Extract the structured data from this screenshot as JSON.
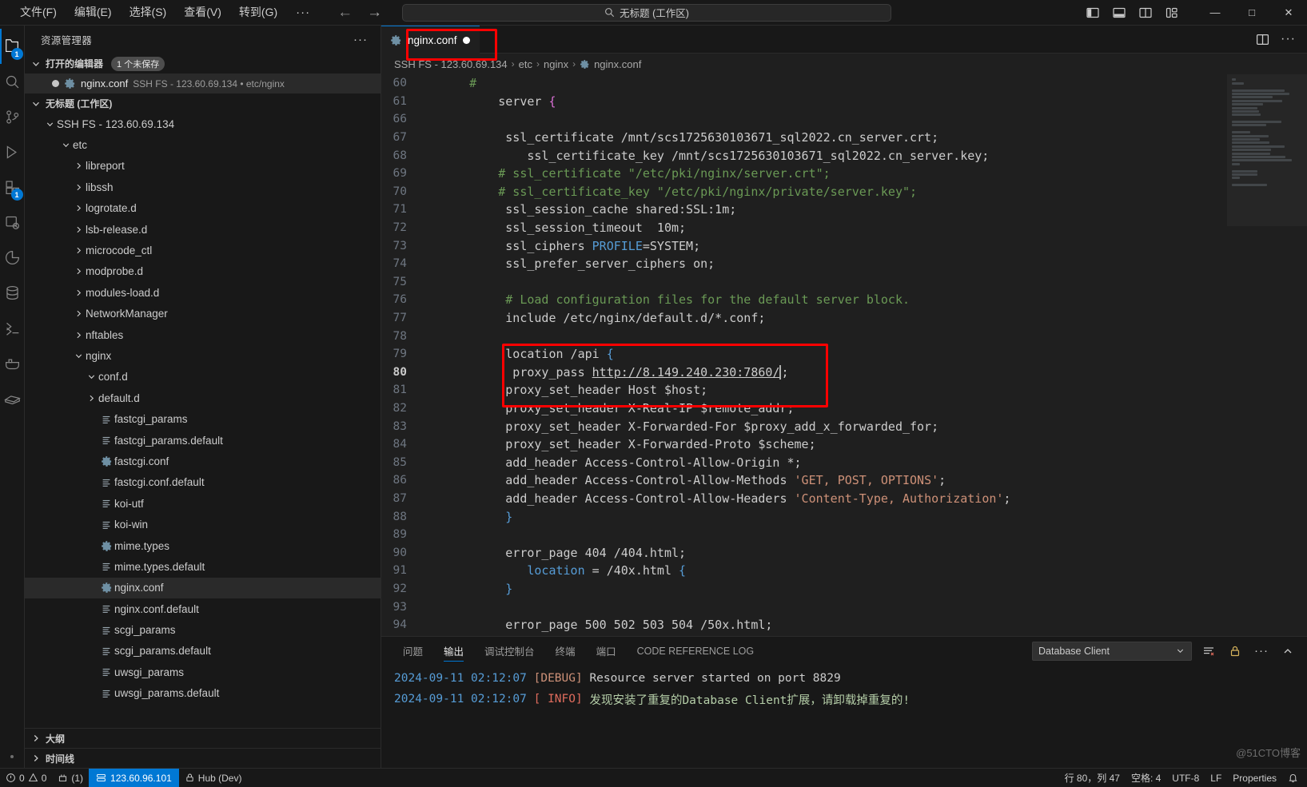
{
  "titlebar": {
    "menus": [
      {
        "label": "文件(F)",
        "name": "menu-file"
      },
      {
        "label": "编辑(E)",
        "name": "menu-edit"
      },
      {
        "label": "选择(S)",
        "name": "menu-selection"
      },
      {
        "label": "查看(V)",
        "name": "menu-view"
      },
      {
        "label": "转到(G)",
        "name": "menu-go"
      }
    ],
    "more_label": "···",
    "back_glyph": "←",
    "forward_glyph": "→",
    "command_center_text": "无标题 (工作区)",
    "minimize_glyph": "—",
    "maximize_glyph": "□",
    "close_glyph": "✕"
  },
  "activitybar": {
    "items": [
      {
        "name": "explorer-icon",
        "badge": "1"
      },
      {
        "name": "search-icon",
        "badge": ""
      },
      {
        "name": "source-control-icon",
        "badge": ""
      },
      {
        "name": "run-debug-icon",
        "badge": ""
      },
      {
        "name": "extensions-icon",
        "badge": "1"
      },
      {
        "name": "remote-explorer-icon",
        "badge": ""
      },
      {
        "name": "test-icon",
        "badge": ""
      },
      {
        "name": "database-icon",
        "badge": ""
      },
      {
        "name": "code-runner-icon",
        "badge": ""
      },
      {
        "name": "docker-icon",
        "badge": ""
      },
      {
        "name": "ssh-fs-icon",
        "badge": ""
      }
    ]
  },
  "sidebar": {
    "title": "资源管理器",
    "more_actions": "···",
    "open_editors": {
      "label": "打开的编辑器",
      "unsaved_badge": "1 个未保存",
      "rows": [
        {
          "name": "nginx.conf",
          "description": "SSH FS - 123.60.69.134 • etc/nginx",
          "icon": "gear-icon",
          "dirty": true
        }
      ]
    },
    "workspace": {
      "label": "无标题 (工作区)",
      "root": "SSH FS - 123.60.69.134"
    },
    "tree": [
      {
        "label": "etc",
        "type": "folder",
        "expanded": true,
        "depth": 2,
        "icon": "chevron-down-icon"
      },
      {
        "label": "libreport",
        "type": "folder",
        "expanded": false,
        "depth": 3,
        "icon": "chevron-right-icon"
      },
      {
        "label": "libssh",
        "type": "folder",
        "expanded": false,
        "depth": 3,
        "icon": "chevron-right-icon"
      },
      {
        "label": "logrotate.d",
        "type": "folder",
        "expanded": false,
        "depth": 3,
        "icon": "chevron-right-icon"
      },
      {
        "label": "lsb-release.d",
        "type": "folder",
        "expanded": false,
        "depth": 3,
        "icon": "chevron-right-icon"
      },
      {
        "label": "microcode_ctl",
        "type": "folder",
        "expanded": false,
        "depth": 3,
        "icon": "chevron-right-icon"
      },
      {
        "label": "modprobe.d",
        "type": "folder",
        "expanded": false,
        "depth": 3,
        "icon": "chevron-right-icon"
      },
      {
        "label": "modules-load.d",
        "type": "folder",
        "expanded": false,
        "depth": 3,
        "icon": "chevron-right-icon"
      },
      {
        "label": "NetworkManager",
        "type": "folder",
        "expanded": false,
        "depth": 3,
        "icon": "chevron-right-icon"
      },
      {
        "label": "nftables",
        "type": "folder",
        "expanded": false,
        "depth": 3,
        "icon": "chevron-right-icon"
      },
      {
        "label": "nginx",
        "type": "folder",
        "expanded": true,
        "depth": 3,
        "icon": "chevron-down-icon"
      },
      {
        "label": "conf.d",
        "type": "folder",
        "expanded": true,
        "depth": 4,
        "icon": "chevron-down-icon"
      },
      {
        "label": "default.d",
        "type": "folder",
        "expanded": false,
        "depth": 4,
        "icon": "chevron-right-icon"
      },
      {
        "label": "fastcgi_params",
        "type": "file",
        "depth": 4,
        "icon": "text-file-icon"
      },
      {
        "label": "fastcgi_params.default",
        "type": "file",
        "depth": 4,
        "icon": "text-file-icon"
      },
      {
        "label": "fastcgi.conf",
        "type": "file",
        "depth": 4,
        "icon": "gear-icon"
      },
      {
        "label": "fastcgi.conf.default",
        "type": "file",
        "depth": 4,
        "icon": "text-file-icon"
      },
      {
        "label": "koi-utf",
        "type": "file",
        "depth": 4,
        "icon": "text-file-icon"
      },
      {
        "label": "koi-win",
        "type": "file",
        "depth": 4,
        "icon": "text-file-icon"
      },
      {
        "label": "mime.types",
        "type": "file",
        "depth": 4,
        "icon": "gear-icon"
      },
      {
        "label": "mime.types.default",
        "type": "file",
        "depth": 4,
        "icon": "text-file-icon"
      },
      {
        "label": "nginx.conf",
        "type": "file",
        "depth": 4,
        "icon": "gear-icon",
        "selected": true
      },
      {
        "label": "nginx.conf.default",
        "type": "file",
        "depth": 4,
        "icon": "text-file-icon"
      },
      {
        "label": "scgi_params",
        "type": "file",
        "depth": 4,
        "icon": "text-file-icon"
      },
      {
        "label": "scgi_params.default",
        "type": "file",
        "depth": 4,
        "icon": "text-file-icon"
      },
      {
        "label": "uwsgi_params",
        "type": "file",
        "depth": 4,
        "icon": "text-file-icon"
      },
      {
        "label": "uwsgi_params.default",
        "type": "file",
        "depth": 4,
        "icon": "text-file-icon"
      }
    ],
    "bottom_sections": [
      {
        "label": "大纲",
        "name": "sidebar-section-outline"
      },
      {
        "label": "时间线",
        "name": "sidebar-section-timeline"
      }
    ]
  },
  "editor": {
    "tab": {
      "label": "nginx.conf",
      "dirty": true,
      "icon": "gear-icon"
    },
    "breadcrumb": [
      "SSH FS - 123.60.69.134",
      "etc",
      "nginx",
      "nginx.conf"
    ],
    "breadcrumb_separator": "›",
    "lines": [
      {
        "num": "60",
        "segments": [
          {
            "t": "    #",
            "c": "cm"
          }
        ]
      },
      {
        "num": "61",
        "segments": [
          {
            "t": "        server ",
            "c": "plain"
          },
          {
            "t": "{",
            "c": "punc"
          }
        ]
      },
      {
        "num": "66",
        "segments": []
      },
      {
        "num": "67",
        "segments": [
          {
            "t": "         ssl_certificate /mnt/scs1725630103671_sql2022.cn_server.crt;",
            "c": "plain"
          }
        ]
      },
      {
        "num": "68",
        "segments": [
          {
            "t": "            ssl_certificate_key /mnt/scs1725630103671_sql2022.cn_server.key;",
            "c": "plain"
          }
        ]
      },
      {
        "num": "69",
        "segments": [
          {
            "t": "        # ssl_certificate \"/etc/pki/nginx/server.crt\";",
            "c": "cm"
          }
        ]
      },
      {
        "num": "70",
        "segments": [
          {
            "t": "        # ssl_certificate_key \"/etc/pki/nginx/private/server.key\";",
            "c": "cm"
          }
        ]
      },
      {
        "num": "71",
        "segments": [
          {
            "t": "         ssl_session_cache shared:SSL:1m;",
            "c": "plain"
          }
        ]
      },
      {
        "num": "72",
        "segments": [
          {
            "t": "         ssl_session_timeout  10m;",
            "c": "plain"
          }
        ]
      },
      {
        "num": "73",
        "segments": [
          {
            "t": "         ssl_ciphers ",
            "c": "plain"
          },
          {
            "t": "PROFILE",
            "c": "kw"
          },
          {
            "t": "=SYSTEM;",
            "c": "plain"
          }
        ]
      },
      {
        "num": "74",
        "segments": [
          {
            "t": "         ssl_prefer_server_ciphers on;",
            "c": "plain"
          }
        ]
      },
      {
        "num": "75",
        "segments": []
      },
      {
        "num": "76",
        "segments": [
          {
            "t": "         # Load configuration files for the default server block.",
            "c": "cm"
          }
        ]
      },
      {
        "num": "77",
        "segments": [
          {
            "t": "         include /etc/nginx/default.d/*.conf;",
            "c": "plain"
          }
        ]
      },
      {
        "num": "78",
        "segments": []
      },
      {
        "num": "79",
        "segments": [
          {
            "t": "         location /api ",
            "c": "plain"
          },
          {
            "t": "{",
            "c": "kw"
          }
        ]
      },
      {
        "num": "80",
        "segments": [
          {
            "t": "          proxy_pass ",
            "c": "plain"
          },
          {
            "t": "http://8.149.240.230:7860/",
            "c": "link"
          },
          {
            "t": ";",
            "c": "plain"
          }
        ],
        "current": true
      },
      {
        "num": "81",
        "segments": [
          {
            "t": "         proxy_set_header Host $host;",
            "c": "plain"
          }
        ]
      },
      {
        "num": "82",
        "segments": [
          {
            "t": "         proxy_set_header X-Real-IP $remote_addr;",
            "c": "plain"
          }
        ]
      },
      {
        "num": "83",
        "segments": [
          {
            "t": "         proxy_set_header X-Forwarded-For $proxy_add_x_forwarded_for;",
            "c": "plain"
          }
        ]
      },
      {
        "num": "84",
        "segments": [
          {
            "t": "         proxy_set_header X-Forwarded-Proto $scheme;",
            "c": "plain"
          }
        ]
      },
      {
        "num": "85",
        "segments": [
          {
            "t": "         add_header Access-Control-Allow-Origin *;",
            "c": "plain"
          }
        ]
      },
      {
        "num": "86",
        "segments": [
          {
            "t": "         add_header Access-Control-Allow-Methods ",
            "c": "plain"
          },
          {
            "t": "'GET, POST, OPTIONS'",
            "c": "str"
          },
          {
            "t": ";",
            "c": "plain"
          }
        ]
      },
      {
        "num": "87",
        "segments": [
          {
            "t": "         add_header Access-Control-Allow-Headers ",
            "c": "plain"
          },
          {
            "t": "'Content-Type, Authorization'",
            "c": "str"
          },
          {
            "t": ";",
            "c": "plain"
          }
        ]
      },
      {
        "num": "88",
        "segments": [
          {
            "t": "         ",
            "c": "plain"
          },
          {
            "t": "}",
            "c": "kw"
          }
        ]
      },
      {
        "num": "89",
        "segments": []
      },
      {
        "num": "90",
        "segments": [
          {
            "t": "         error_page 404 /404.html;",
            "c": "plain"
          }
        ]
      },
      {
        "num": "91",
        "segments": [
          {
            "t": "            ",
            "c": "plain"
          },
          {
            "t": "location",
            "c": "kw"
          },
          {
            "t": " = /40x.html ",
            "c": "plain"
          },
          {
            "t": "{",
            "c": "kw"
          }
        ]
      },
      {
        "num": "92",
        "segments": [
          {
            "t": "         ",
            "c": "plain"
          },
          {
            "t": "}",
            "c": "kw"
          }
        ]
      },
      {
        "num": "93",
        "segments": []
      },
      {
        "num": "94",
        "segments": [
          {
            "t": "         error_page 500 502 503 504 /50x.html;",
            "c": "plain"
          }
        ]
      }
    ]
  },
  "panel": {
    "tabs": [
      {
        "label": "问题",
        "active": false,
        "name": "panel-tab-problems"
      },
      {
        "label": "输出",
        "active": true,
        "name": "panel-tab-output"
      },
      {
        "label": "调试控制台",
        "active": false,
        "name": "panel-tab-debug-console"
      },
      {
        "label": "终端",
        "active": false,
        "name": "panel-tab-terminal"
      },
      {
        "label": "端口",
        "active": false,
        "name": "panel-tab-ports"
      },
      {
        "label": "CODE REFERENCE LOG",
        "active": false,
        "name": "panel-tab-code-reference-log"
      }
    ],
    "channel_selected": "Database Client",
    "chevron": "⌄",
    "more_glyph": "···",
    "collapse_glyph": "⌃",
    "log": [
      {
        "time": "2024-09-11 02:12:07",
        "level": "[DEBUG]",
        "level_class": "lg-debug",
        "message": "Resource server started on port 8829",
        "message_class": "lg-msg"
      },
      {
        "time": "2024-09-11 02:12:07",
        "level": "[ INFO]",
        "level_class": "lg-info",
        "message": "发现安装了重复的Database Client扩展，请卸载掉重复的!",
        "message_class": "lg-msg-green"
      }
    ]
  },
  "statusbar": {
    "remote_label": "123.60.96.101",
    "left_items": [
      "0",
      "0",
      "(1)",
      "Hub (Dev)"
    ],
    "right_items": [
      "行 80，列 47",
      "空格: 4",
      "UTF-8",
      "LF",
      "Properties"
    ]
  },
  "watermark": "@51CTO博客",
  "colors": {
    "accent": "#0078d4",
    "annotation": "#ff0000",
    "tab_active_bg": "#1f1f1f",
    "sidebar_bg": "#181818",
    "editor_bg": "#1f1f1f"
  }
}
